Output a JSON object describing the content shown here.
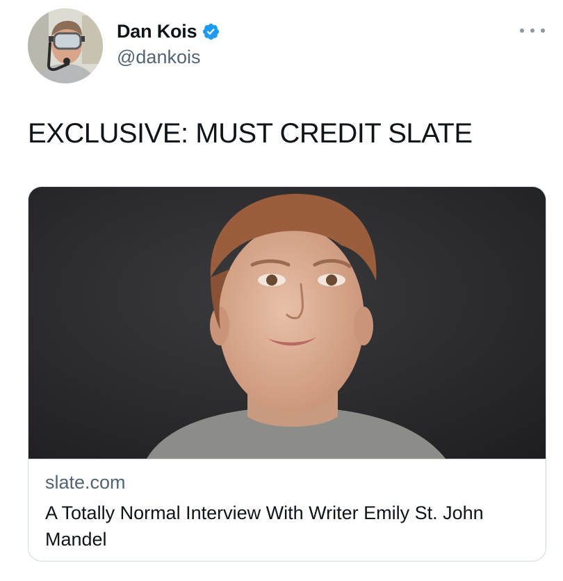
{
  "author": {
    "display_name": "Dan Kois",
    "handle": "@dankois",
    "verified": true,
    "avatar_icon": "profile-photo-snorkel-mask"
  },
  "tweet": {
    "text": "EXCLUSIVE: MUST CREDIT SLATE"
  },
  "link_card": {
    "image_icon": "portrait-photo",
    "domain": "slate.com",
    "title": "A Totally Normal Interview With Writer Emily St. John Mandel"
  },
  "colors": {
    "text_primary": "#0f1419",
    "text_secondary": "#536471",
    "verified_blue": "#1d9bf0",
    "card_border": "#cfd9de"
  }
}
